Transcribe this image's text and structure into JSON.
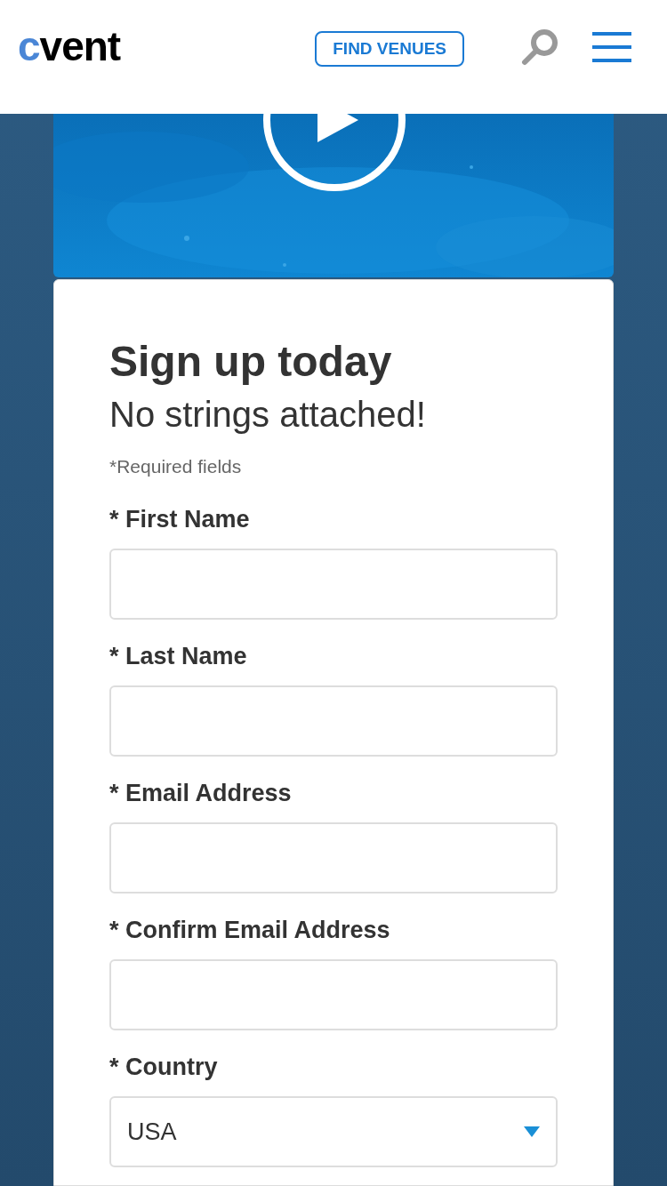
{
  "header": {
    "logo": {
      "accent": "c",
      "rest": "vent"
    },
    "find_venues_button": "FIND VENUES"
  },
  "form": {
    "title": "Sign up today",
    "subtitle": "No strings attached!",
    "required_note": "*Required fields",
    "fields": [
      {
        "kind": "text",
        "label": "* First Name"
      },
      {
        "kind": "text",
        "label": "* Last Name"
      },
      {
        "kind": "text",
        "label": "* Email Address"
      },
      {
        "kind": "text",
        "label": "* Confirm Email Address"
      },
      {
        "kind": "select",
        "label": "* Country",
        "value": "USA"
      }
    ]
  }
}
